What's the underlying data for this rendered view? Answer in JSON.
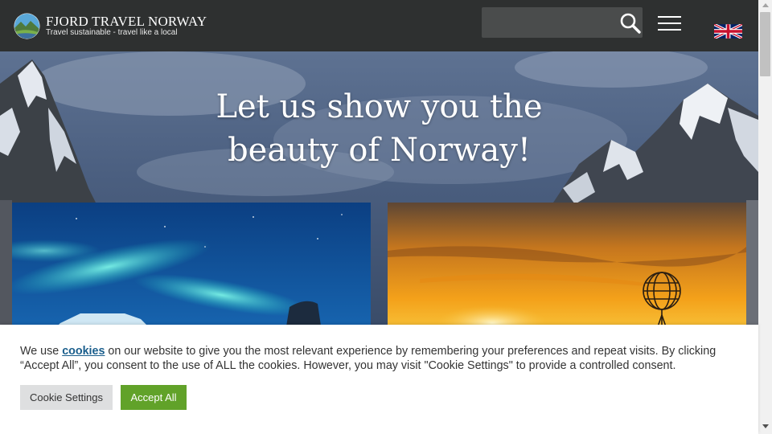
{
  "header": {
    "brand_name": "FJORD TRAVEL NORWAY",
    "tagline": "Travel sustainable - travel like a local",
    "search": {
      "placeholder": "",
      "value": "",
      "icon": "search-icon"
    },
    "menu_icon": "hamburger-menu-icon",
    "language_icon": "uk-flag-icon"
  },
  "hero": {
    "title_line1": "Let us show you the",
    "title_line2": "beauty of Norway!",
    "cards": [
      {
        "image": "northern-lights-photo"
      },
      {
        "image": "north-cape-sunset-globe-photo"
      }
    ]
  },
  "cookie_banner": {
    "text_before_link": "We use ",
    "link_text": "cookies",
    "text_after_link": " on our website to give you the most relevant experience by remembering your preferences and repeat visits. By clicking “Accept All”, you consent to the use of ALL the cookies. However, you may visit \"Cookie Settings\" to provide a controlled consent.",
    "settings_button": "Cookie Settings",
    "accept_button": "Accept All"
  },
  "colors": {
    "header_bg": "#2e3030",
    "accept_green": "#61a229",
    "settings_gray": "#dedfe0",
    "link_blue": "#1a5e8c"
  }
}
